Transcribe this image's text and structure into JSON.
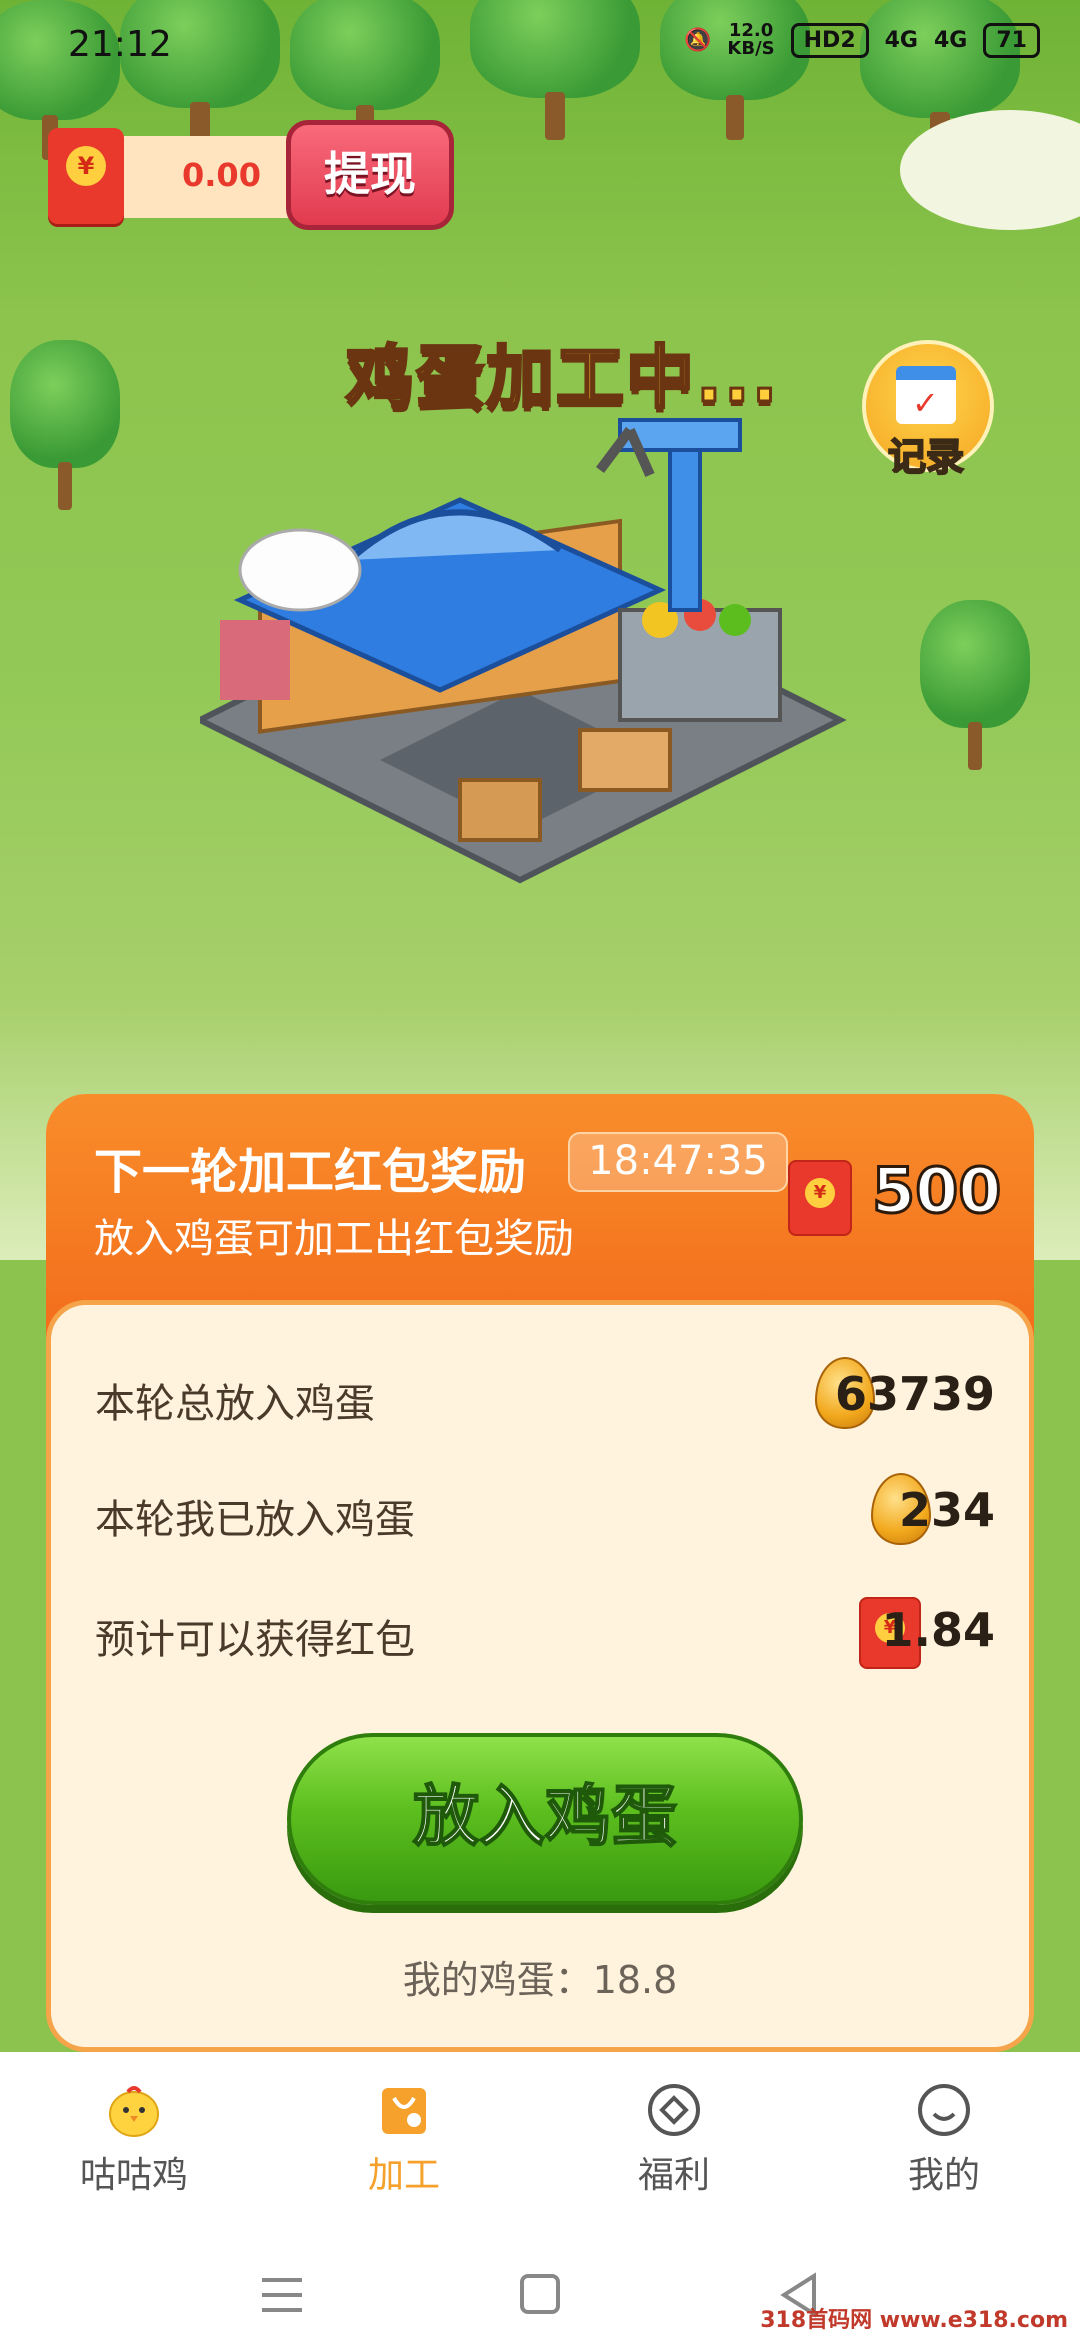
{
  "status_bar": {
    "time": "21:12",
    "net_speed": "12.0",
    "net_unit": "KB/S",
    "hd": "HD2",
    "signal_1": "4G",
    "signal_2": "4G",
    "battery": "71"
  },
  "wallet": {
    "amount": "0.00",
    "withdraw_label": "提现"
  },
  "scene": {
    "processing_text": "鸡蛋加工中...",
    "record_label": "记录"
  },
  "reward_card": {
    "title": "下一轮加工红包奖励",
    "timer": "18:47:35",
    "subtitle": "放入鸡蛋可加工出红包奖励",
    "reward_amount": "500"
  },
  "stats": [
    {
      "label": "本轮总放入鸡蛋",
      "value": "63739",
      "icon": "egg-icon"
    },
    {
      "label": "本轮我已放入鸡蛋",
      "value": "234",
      "icon": "egg-icon"
    },
    {
      "label": "预计可以获得红包",
      "value": "1.84",
      "icon": "red-envelope-icon"
    }
  ],
  "action": {
    "put_button": "放入鸡蛋",
    "my_eggs": "我的鸡蛋：18.8"
  },
  "tabs": [
    {
      "label": "咕咕鸡",
      "icon": "chick-icon"
    },
    {
      "label": "加工",
      "icon": "factory-bag-icon",
      "active": true
    },
    {
      "label": "福利",
      "icon": "diamond-circle-icon"
    },
    {
      "label": "我的",
      "icon": "smile-icon"
    }
  ],
  "watermark": "318首码网 www.e318.com",
  "colors": {
    "accent_orange": "#f26b1b",
    "button_green": "#5cbe1e",
    "envelope_red": "#e8392c",
    "active_tab": "#f5a12c"
  }
}
